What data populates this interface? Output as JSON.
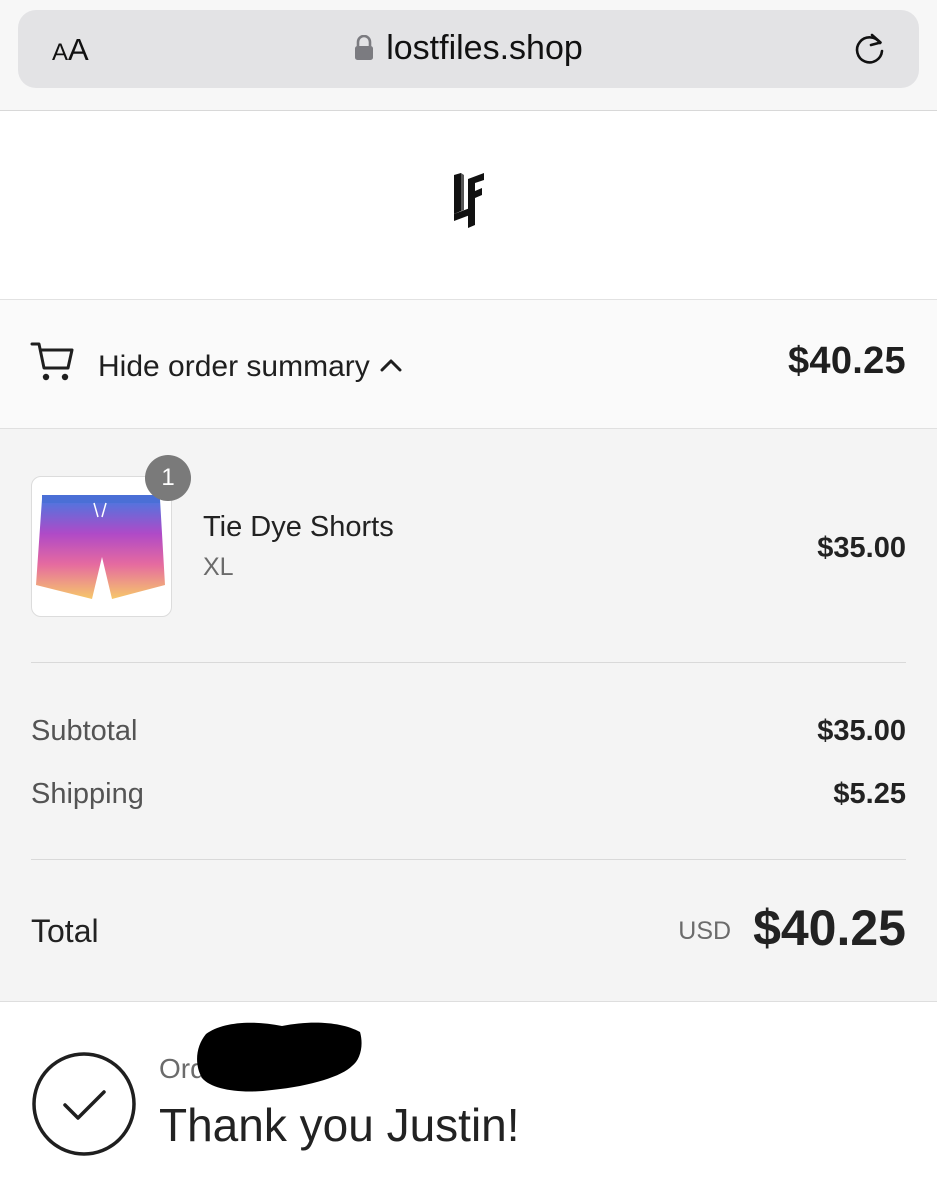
{
  "browser": {
    "text_size_label_small": "A",
    "text_size_label_large": "A",
    "url": "lostfiles.shop",
    "icons": [
      "lock-icon",
      "reload-icon"
    ]
  },
  "store": {
    "logo_text": "LF",
    "logo_icon": "lf-logo"
  },
  "summary_toggle": {
    "label": "Hide order summary",
    "total": "$40.25",
    "icons": [
      "cart-icon",
      "chevron-up-icon"
    ]
  },
  "line_items": [
    {
      "name": "Tie Dye Shorts",
      "variant": "XL",
      "price": "$35.00",
      "quantity": "1",
      "thumbnail_icon": "tie-dye-shorts-image"
    }
  ],
  "costs": {
    "subtotal_label": "Subtotal",
    "subtotal_value": "$35.00",
    "shipping_label": "Shipping",
    "shipping_value": "$5.25",
    "total_label": "Total",
    "currency": "USD",
    "total_value": "$40.25"
  },
  "confirmation": {
    "order_label": "Order",
    "thank_you": "Thank you Justin!",
    "icon": "check-circle-icon"
  },
  "colors": {
    "panel_background": "#f4f4f4",
    "badge": "#7a7a7a",
    "text_primary": "#1f1f1f",
    "text_muted": "#6b6b6b"
  }
}
